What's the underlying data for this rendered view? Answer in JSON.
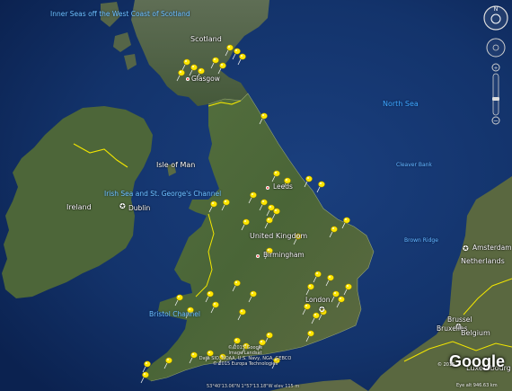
{
  "map": {
    "labels": {
      "inner_seas": "Inner Seas off the West Coast of Scotland",
      "scotland": "Scotland",
      "glasgow": "Glasgow",
      "north_sea": "North Sea",
      "isle_of_man": "Isle of Man",
      "irish_sea": "Irish Sea and St. George's Channel",
      "ireland": "Ireland",
      "dublin": "Dublin",
      "leeds": "Leeds",
      "uk": "United Kingdom",
      "birmingham": "Birmingham",
      "cleaver_bank": "Cleaver Bank",
      "brown_ridge": "Brown Ridge",
      "amsterdam": "Amsterdam",
      "netherlands": "Netherlands",
      "london": "London",
      "bristol_channel": "Bristol Channel",
      "brussel": "Brussel",
      "bruxelles": "Bruxelles",
      "belgium": "Belgium",
      "luxembourg": "Luxembourg"
    },
    "attribution": [
      "© 2015 Google",
      "Image Landsat",
      "Data SIO, NOAA, U.S. Navy, NGA, GEBCO",
      "© 2015 Europa Technologies"
    ],
    "status_bar": "53°40'13.06\"N  1°57'13.18\"W  elev  115 m",
    "eye_alt": "Eye alt  946.63 km",
    "logo": "Google",
    "logo_year": "© 2015",
    "colors": {
      "sea": "#13336b",
      "land": "#4f6b3c",
      "pin": "#ffe600",
      "border": "#f2e600"
    }
  }
}
